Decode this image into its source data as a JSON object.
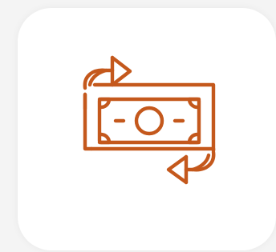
{
  "app_tile": {
    "icon": "money-exchange-icon",
    "accent_color": "#c4581c",
    "background_color": "#ffffff"
  }
}
